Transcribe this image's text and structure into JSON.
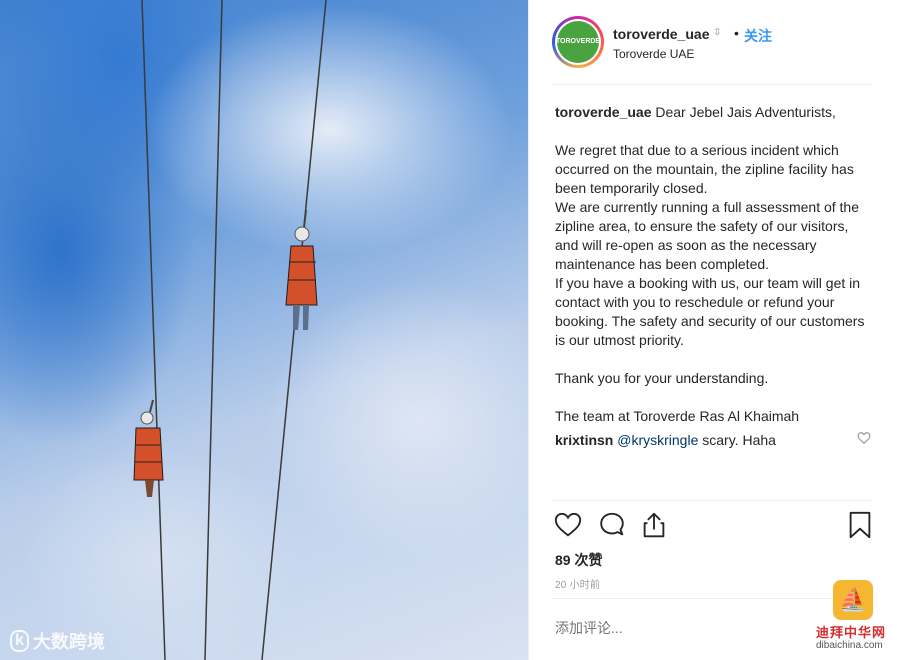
{
  "post": {
    "username": "toroverde_uae",
    "follow_label": "关注",
    "separator": "•",
    "location": "Toroverde UAE",
    "avatar_text": "TOROVERDE",
    "caption_lines": [
      "Dear Jebel Jais Adventurists,",
      "We regret that due to a serious incident which occurred on the mountain, the zipline facility has been temporarily closed.",
      "We are currently running a full assessment of the zipline area, to ensure the safety of our visitors, and will re-open as soon as the necessary maintenance has been completed.",
      "If you have a booking with us, our team will get in contact with you to reschedule or refund your booking. The safety and security of our customers is our utmost priority.",
      "Thank you for your understanding.",
      "The team at Toroverde Ras Al Khaimah"
    ],
    "comment": {
      "username": "krixtinsn",
      "mention": "@kryskringle",
      "text": " scary. Haha"
    },
    "likes": "89 次赞",
    "timestamp": "20 小时前",
    "add_comment_placeholder": "添加评论...",
    "icons": [
      "heart-icon",
      "comment-icon",
      "share-icon",
      "bookmark-icon"
    ]
  },
  "watermarks": {
    "left_text": "大数跨境",
    "left_logo": "k",
    "right_cn": "迪拜中华网",
    "right_en": "dibaichina.com"
  }
}
